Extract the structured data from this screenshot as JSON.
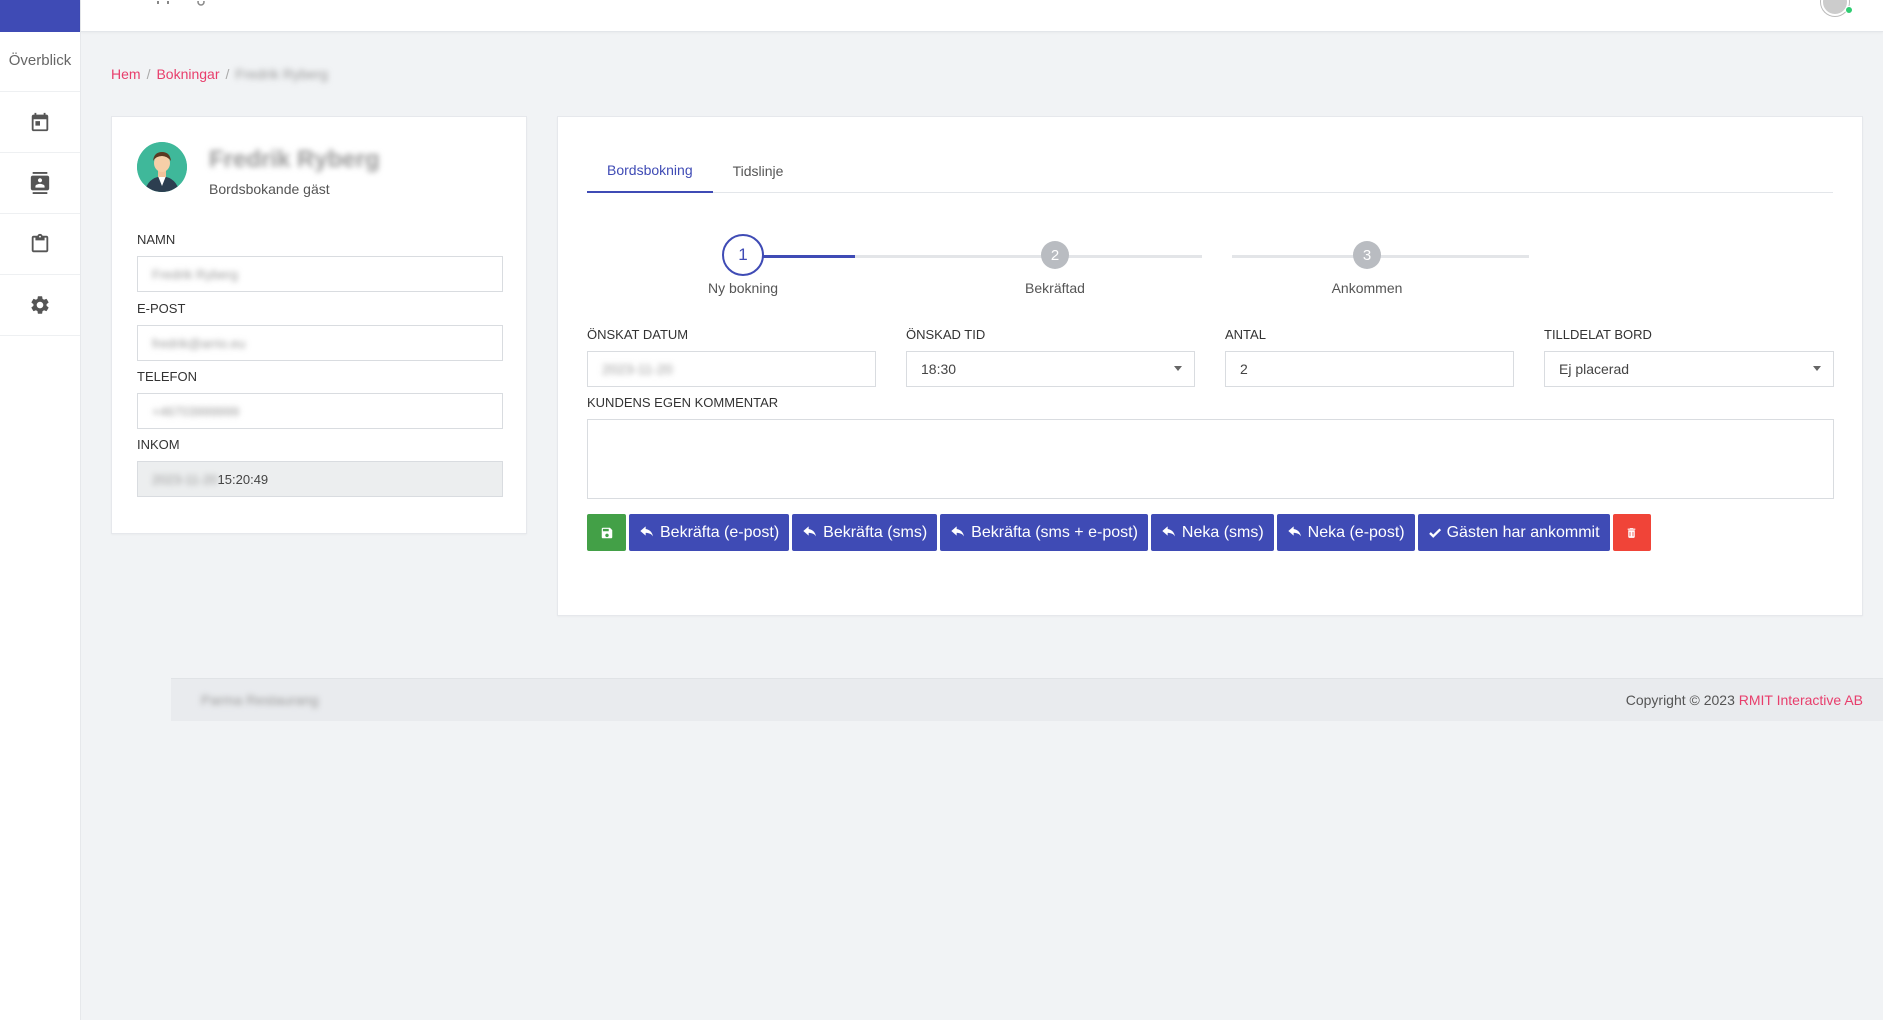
{
  "sidebar": {
    "label": "Överblick",
    "items": [
      {
        "icon": "calendar-icon"
      },
      {
        "icon": "contact-book-icon"
      },
      {
        "icon": "clipboard-icon"
      },
      {
        "icon": "gear-icon"
      }
    ]
  },
  "topbar": {
    "icons": [
      "menu-icon",
      "fullscreen-icon",
      "search-icon"
    ]
  },
  "breadcrumb": {
    "home": "Hem",
    "section": "Bokningar",
    "current": "Fredrik Ryberg"
  },
  "guest": {
    "name": "Fredrik Ryberg",
    "subtitle": "Bordsbokande gäst",
    "fields": {
      "name_label": "NAMN",
      "name_value": "Fredrik Ryberg",
      "email_label": "E-POST",
      "email_value": "fredrik@arrio.eu",
      "phone_label": "TELEFON",
      "phone_value": "+46703999999",
      "incoming_label": "INKOM",
      "incoming_date": "2023-11-20",
      "incoming_time": "15:20:49"
    }
  },
  "tabs": [
    {
      "label": "Bordsbokning",
      "active": true
    },
    {
      "label": "Tidslinje",
      "active": false
    }
  ],
  "stepper": {
    "steps": [
      {
        "number": "1",
        "label": "Ny bokning",
        "active": true
      },
      {
        "number": "2",
        "label": "Bekräftad",
        "active": false
      },
      {
        "number": "3",
        "label": "Ankommen",
        "active": false
      }
    ]
  },
  "booking": {
    "date_label": "ÖNSKAT DATUM",
    "date_value": "2023-11-20",
    "time_label": "ÖNSKAD TID",
    "time_value": "18:30",
    "count_label": "ANTAL",
    "count_value": "2",
    "table_label": "TILLDELAT BORD",
    "table_value": "Ej placerad",
    "comment_label": "KUNDENS EGEN KOMMENTAR",
    "comment_value": ""
  },
  "actions": {
    "confirm_email": "Bekräfta (e-post)",
    "confirm_sms": "Bekräfta (sms)",
    "confirm_both": "Bekräfta (sms + e-post)",
    "deny_sms": "Neka (sms)",
    "deny_email": "Neka (e-post)",
    "arrived": "Gästen har ankommit"
  },
  "footer": {
    "left": "Parma Restaurang",
    "copyright": "Copyright © 2023",
    "company": "RMIT Interactive AB"
  },
  "colors": {
    "primary": "#3f4bb5",
    "accent": "#e83e6c",
    "success": "#43a047",
    "danger": "#f04438"
  }
}
